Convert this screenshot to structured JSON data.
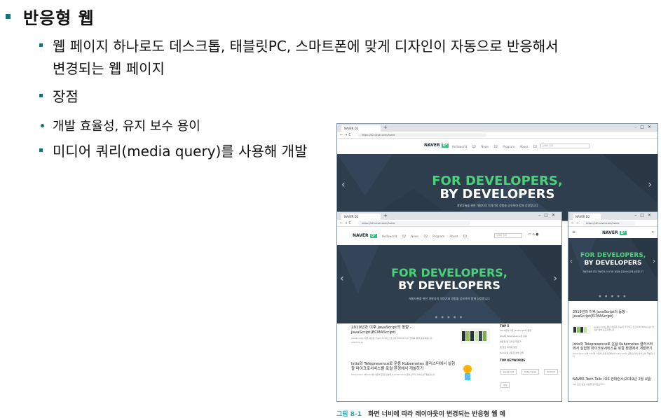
{
  "slide": {
    "title": "반응형 웹",
    "bullets": [
      "웹 페이지 하나로도 데스크톱, 태블릿PC, 스마트폰에 맞게 디자인이 자동으로 반응해서",
      "변경되는 웹 페이지",
      "장점",
      "개발 효율성, 유지 보수 용이",
      "미디어 쿼리(media query)를 사용해 개발"
    ],
    "caption_number": "그림 8-1",
    "caption_text": "화면 너비에 따라 레이아웃이 변경되는 반응형 웹 예"
  },
  "site": {
    "tab_title": "NAVER D2",
    "url": "https://d2.naver.com/home",
    "brand": "NAVER",
    "brand_badge": "D²",
    "nav": [
      "Helloworld",
      "D2 News",
      "D2 Program",
      "About D2"
    ],
    "search_placeholder": "검색어 입력",
    "hero_line1": "FOR DEVELOPERS,",
    "hero_line2": "BY DEVELOPERS",
    "hero_sub": "개발자들을 위한 개발자의 이야기와 경험을 공유하여 함께 성장합니다",
    "articles": [
      {
        "title": "2019년과 이후 JavaScript의 동향 - JavaScript(ECMAScript)",
        "snippet": "JavaScript는 매년 새로운 기능이 추가되고 있으며 ECMAScript 명세를 통해 표준화됩니다."
      },
      {
        "title": "Istio와 Telepresence로 운용 Kubernetes 클러스터에서 실험할 마이크로서비스를 로컬 환경에서 개발하기",
        "snippet": "Telepresence와 Istio를 사용해 로컬 환경에서 Kubernetes 클러스터의 서비스를 개발합니다."
      },
      {
        "title": "NAVER Tech Talk: iOS 컨퍼런스(2019년 2월 4일)",
        "snippet": "iOS 관련 발표 내용을 정리했습니다."
      }
    ],
    "top5_title": "TOP 5",
    "top5": [
      "2019년과 이후 JavaScript의 동향",
      "Istio와 Telepresence로 운용",
      "반응형 웹 디자인 적용기",
      "웹 폰트 최적화 방법",
      "Redux를 사용한 상태 관리"
    ],
    "keywords_title": "TOP KEYWORDS",
    "keywords": [
      "JavaScript",
      "Kubernetes",
      "Android",
      "iOS",
      "DEVIEW"
    ],
    "date": "2019.03.12"
  }
}
